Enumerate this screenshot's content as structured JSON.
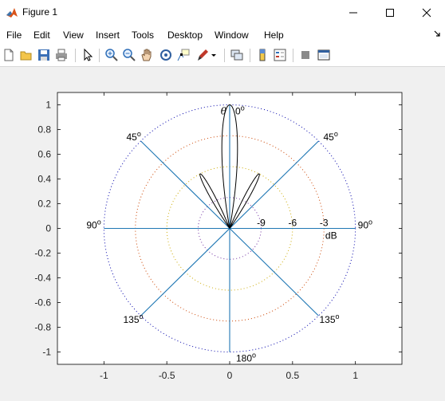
{
  "window": {
    "title": "Figure 1",
    "minimize_glyph": "—",
    "maximize_glyph": "☐",
    "close_glyph": "✕"
  },
  "menu": {
    "items": [
      {
        "label": "File"
      },
      {
        "label": "Edit"
      },
      {
        "label": "View"
      },
      {
        "label": "Insert"
      },
      {
        "label": "Tools"
      },
      {
        "label": "Desktop"
      },
      {
        "label": "Window"
      },
      {
        "label": "Help"
      }
    ]
  },
  "toolbar": {
    "buttons": [
      {
        "icon": "new-figure-icon"
      },
      {
        "icon": "open-file-icon"
      },
      {
        "icon": "save-icon"
      },
      {
        "icon": "print-icon"
      },
      {
        "icon": "edit-plot-icon"
      },
      {
        "icon": "zoom-in-icon"
      },
      {
        "icon": "zoom-out-icon"
      },
      {
        "icon": "pan-icon"
      },
      {
        "icon": "rotate-3d-icon"
      },
      {
        "icon": "data-cursor-icon"
      },
      {
        "icon": "brush-icon"
      },
      {
        "icon": "link-plot-icon"
      },
      {
        "icon": "colorbar-icon"
      },
      {
        "icon": "legend-icon"
      },
      {
        "icon": "hide-plot-tools-icon"
      },
      {
        "icon": "show-plot-tools-icon"
      }
    ]
  },
  "chart_data": {
    "type": "polar",
    "title": "",
    "x_ticks": [
      "-1",
      "-0.5",
      "0",
      "0.5",
      "1"
    ],
    "y_ticks": [
      "1",
      "0.8",
      "0.6",
      "0.4",
      "0.2",
      "0",
      "-0.2",
      "-0.4",
      "-0.6",
      "-0.8",
      "-1"
    ],
    "xlim": [
      -1.37,
      1.37
    ],
    "ylim": [
      -1.1,
      1.1
    ],
    "axis_color": "#000000",
    "spoke_color": "#1f77b4",
    "circle_colors": [
      "#0000aa",
      "#cc4400",
      "#ccaa00",
      "#7030a0"
    ],
    "pattern_color": "#000000",
    "angle_labels": {
      "top": "0",
      "bottom": "180",
      "left": "90",
      "right": "90",
      "upper_left": "45",
      "upper_right": "45",
      "lower_left": "135",
      "lower_right": "135",
      "theta": "θ",
      "degree_sign": "o"
    },
    "db_labels": [
      "-9",
      "-6",
      "-3"
    ],
    "db_unit": "dB",
    "db_rings": [
      -12,
      -9,
      -6,
      -3,
      0
    ],
    "pattern_lobes": [
      {
        "center_deg": 0,
        "half_width_deg": 10,
        "peak": 1.0
      },
      {
        "center_deg": -28,
        "half_width_deg": 6,
        "peak": 0.5
      },
      {
        "center_deg": 28,
        "half_width_deg": 6,
        "peak": 0.5
      }
    ]
  }
}
